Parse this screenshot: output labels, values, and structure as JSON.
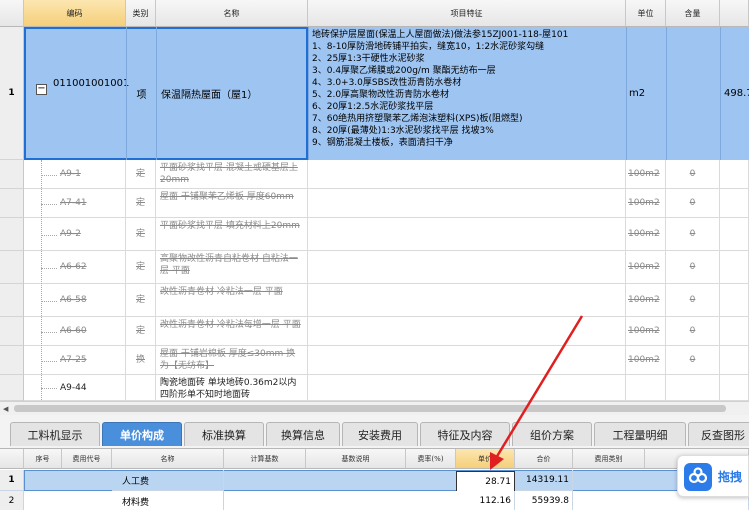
{
  "grid": {
    "headers": [
      "编码",
      "类别",
      "名称",
      "项目特征",
      "单位",
      "含量"
    ],
    "rows": [
      {
        "row_num": "1",
        "code": "011001001001",
        "category": "项",
        "name": "保温隔热屋面（屋1）",
        "features": [
          "地砖保护层屋面(保温上人屋面做法)做法参15ZJ001-118-屋101",
          "1、8-10厚防滑地砖铺平拍实，缝宽10，1:2水泥砂浆勾缝",
          "2、25厚1:3干硬性水泥砂浆",
          "3、0.4厚聚乙烯膜或200g/m  聚酯无纺布一层",
          "4、3.0+3.0厚SBS改性沥青防水卷材",
          "5、2.0厚高聚物改性沥青防水卷材",
          "6、20厚1:2.5水泥砂浆找平层",
          "7、60绝热用挤塑聚苯乙烯泡沫塑料(XPS)板(阻燃型)",
          "8、20厚(最薄处)1:3水泥砂浆找平层 找坡3%",
          "9、钢筋混凝土楼板，表面清扫干净"
        ],
        "unit": "m2",
        "qty": "498.7"
      },
      {
        "code": "A9-1",
        "category": "定",
        "name": "平面砂浆找平层 混凝土或硬基层上20mm",
        "unit": "100m2",
        "content": "0"
      },
      {
        "code": "A7-41",
        "category": "定",
        "name": "屋面 干铺聚苯乙烯板 厚度60mm",
        "unit": "100m2",
        "content": "0"
      },
      {
        "code": "A9-2",
        "category": "定",
        "name": "平面砂浆找平层 填充材料上20mm",
        "unit": "100m2",
        "content": "0"
      },
      {
        "code": "A6-62",
        "category": "定",
        "name": "高聚物改性沥青自粘卷材 自粘法一层 平面",
        "unit": "100m2",
        "content": "0"
      },
      {
        "code": "A6-58",
        "category": "定",
        "name": "改性沥青卷材 冷粘法一层 平面",
        "unit": "100m2",
        "content": "0"
      },
      {
        "code": "A6-60",
        "category": "定",
        "name": "改性沥青卷材 冷粘法每增一层 平面",
        "unit": "100m2",
        "content": "0"
      },
      {
        "code": "A7-25",
        "category": "换",
        "name": "屋面 干铺岩棉板 厚度≤30mm 换为【无纺布】",
        "unit": "100m2",
        "content": "0"
      },
      {
        "code": "A9-44",
        "category": "",
        "name": "陶瓷地面砖 单块地砖0.36m2以内 四阶形单不知时地面砖",
        "unit": "",
        "content": ""
      }
    ]
  },
  "tabs": [
    "工料机显示",
    "单价构成",
    "标准换算",
    "换算信息",
    "安装费用",
    "特征及内容",
    "组价方案",
    "工程量明细",
    "反查图形"
  ],
  "active_tab": "单价构成",
  "bottom": {
    "headers": [
      "序号",
      "费用代号",
      "名称",
      "计算基数",
      "基数说明",
      "费率(%)",
      "单价",
      "合价",
      "费用类别"
    ],
    "rows": [
      {
        "row_num": "1",
        "name": "人工费",
        "price": "28.71",
        "total": "14319.11"
      },
      {
        "row_num": "2",
        "name": "材料费",
        "price": "112.16",
        "total": "55939.8"
      }
    ]
  },
  "float_button": {
    "label": "拖拽",
    "icon": "baidu-netdisk-icon"
  },
  "colors": {
    "selected_row": "#9ec5f2",
    "active_tab": "#4a8fdc",
    "annotation_arrow": "#e02020",
    "strike_text": "#8a8a8a"
  }
}
